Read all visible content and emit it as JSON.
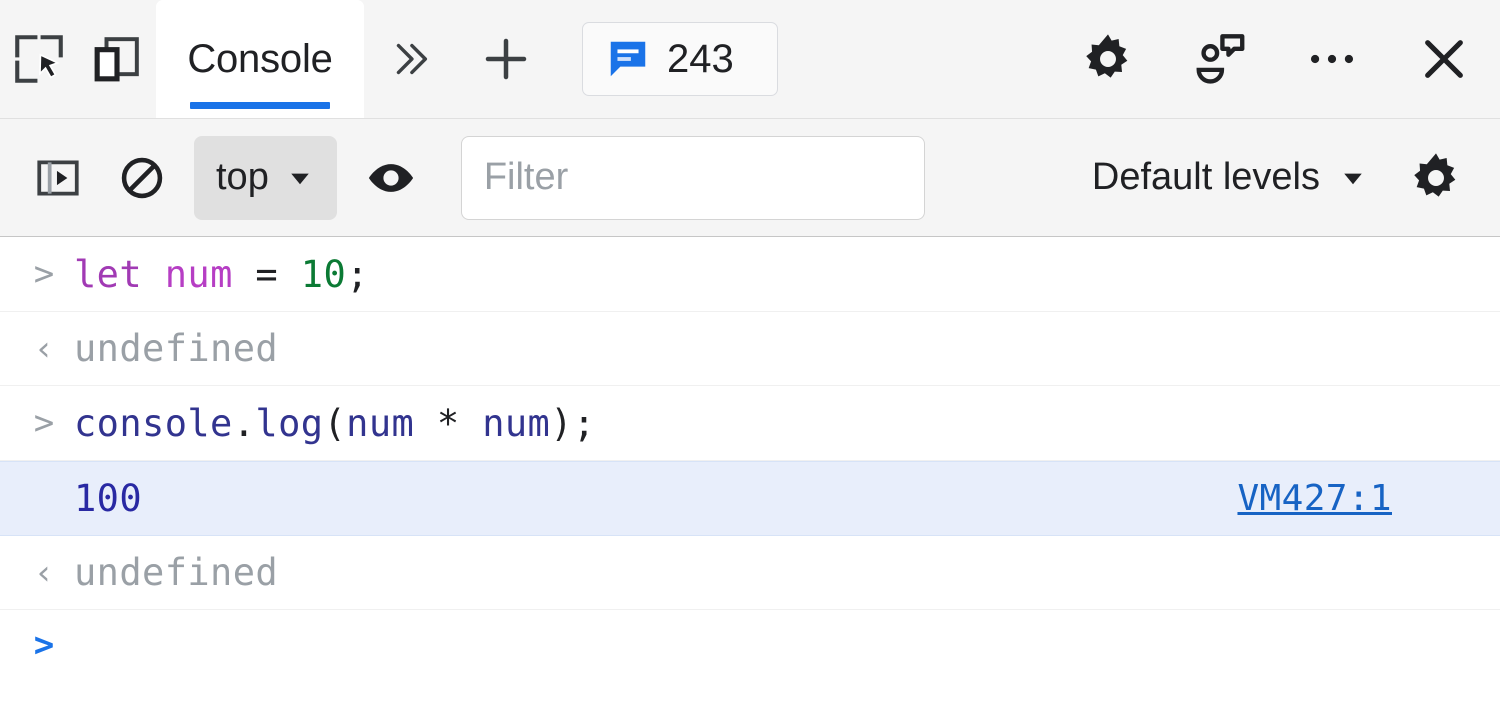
{
  "toolbar": {
    "inspect_icon": "inspect-element-icon",
    "device_icon": "device-toolbar-icon",
    "tabs": [
      {
        "label": "Console",
        "active": true
      }
    ],
    "more_tabs_icon": "chevron-double-right-icon",
    "add_tab_icon": "plus-icon",
    "message_badge": {
      "icon": "message-bubble-icon",
      "count": "243"
    },
    "settings_icon": "gear-icon",
    "feedback_icon": "feedback-icon",
    "more_options_icon": "three-dots-icon",
    "close_icon": "close-icon"
  },
  "filterbar": {
    "sidebar_icon": "console-sidebar-icon",
    "clear_icon": "clear-console-icon",
    "context": {
      "label": "top",
      "caret": "chevron-down-icon"
    },
    "live_expression_icon": "eye-icon",
    "filter": {
      "value": "",
      "placeholder": "Filter"
    },
    "levels": {
      "label": "Default levels",
      "caret": "chevron-down-icon"
    },
    "settings_icon": "gear-icon"
  },
  "console": {
    "rows": [
      {
        "type": "input",
        "gutter": ">",
        "tokens": [
          {
            "text": "let",
            "cls": "tok-kw"
          },
          {
            "text": " ",
            "cls": "tok-punc"
          },
          {
            "text": "num",
            "cls": "tok-var"
          },
          {
            "text": " = ",
            "cls": "tok-punc"
          },
          {
            "text": "10",
            "cls": "tok-num"
          },
          {
            "text": ";",
            "cls": "tok-punc"
          }
        ],
        "plain": "let num = 10;"
      },
      {
        "type": "result",
        "gutter": "‹",
        "plain": "undefined"
      },
      {
        "type": "input",
        "gutter": ">",
        "tokens": [
          {
            "text": "console",
            "cls": "tok-obj"
          },
          {
            "text": ".",
            "cls": "tok-punc"
          },
          {
            "text": "log",
            "cls": "tok-obj"
          },
          {
            "text": "(",
            "cls": "tok-punc"
          },
          {
            "text": "num",
            "cls": "tok-obj"
          },
          {
            "text": " * ",
            "cls": "tok-punc"
          },
          {
            "text": "num",
            "cls": "tok-obj"
          },
          {
            "text": ");",
            "cls": "tok-punc"
          }
        ],
        "plain": "console.log(num * num);"
      },
      {
        "type": "output",
        "gutter": "",
        "plain": "100",
        "source": "VM427:1"
      },
      {
        "type": "result",
        "gutter": "‹",
        "plain": "undefined"
      },
      {
        "type": "prompt",
        "gutter": ">",
        "plain": ""
      }
    ]
  },
  "colors": {
    "accent": "#1a73e8",
    "toolbar_bg": "#f5f5f5",
    "highlight_row": "#e8eefb",
    "link": "#1763c4",
    "keyword": "#a13ab4",
    "number": "#0b7a34",
    "object": "#32348f",
    "muted": "#9aa0a6"
  }
}
